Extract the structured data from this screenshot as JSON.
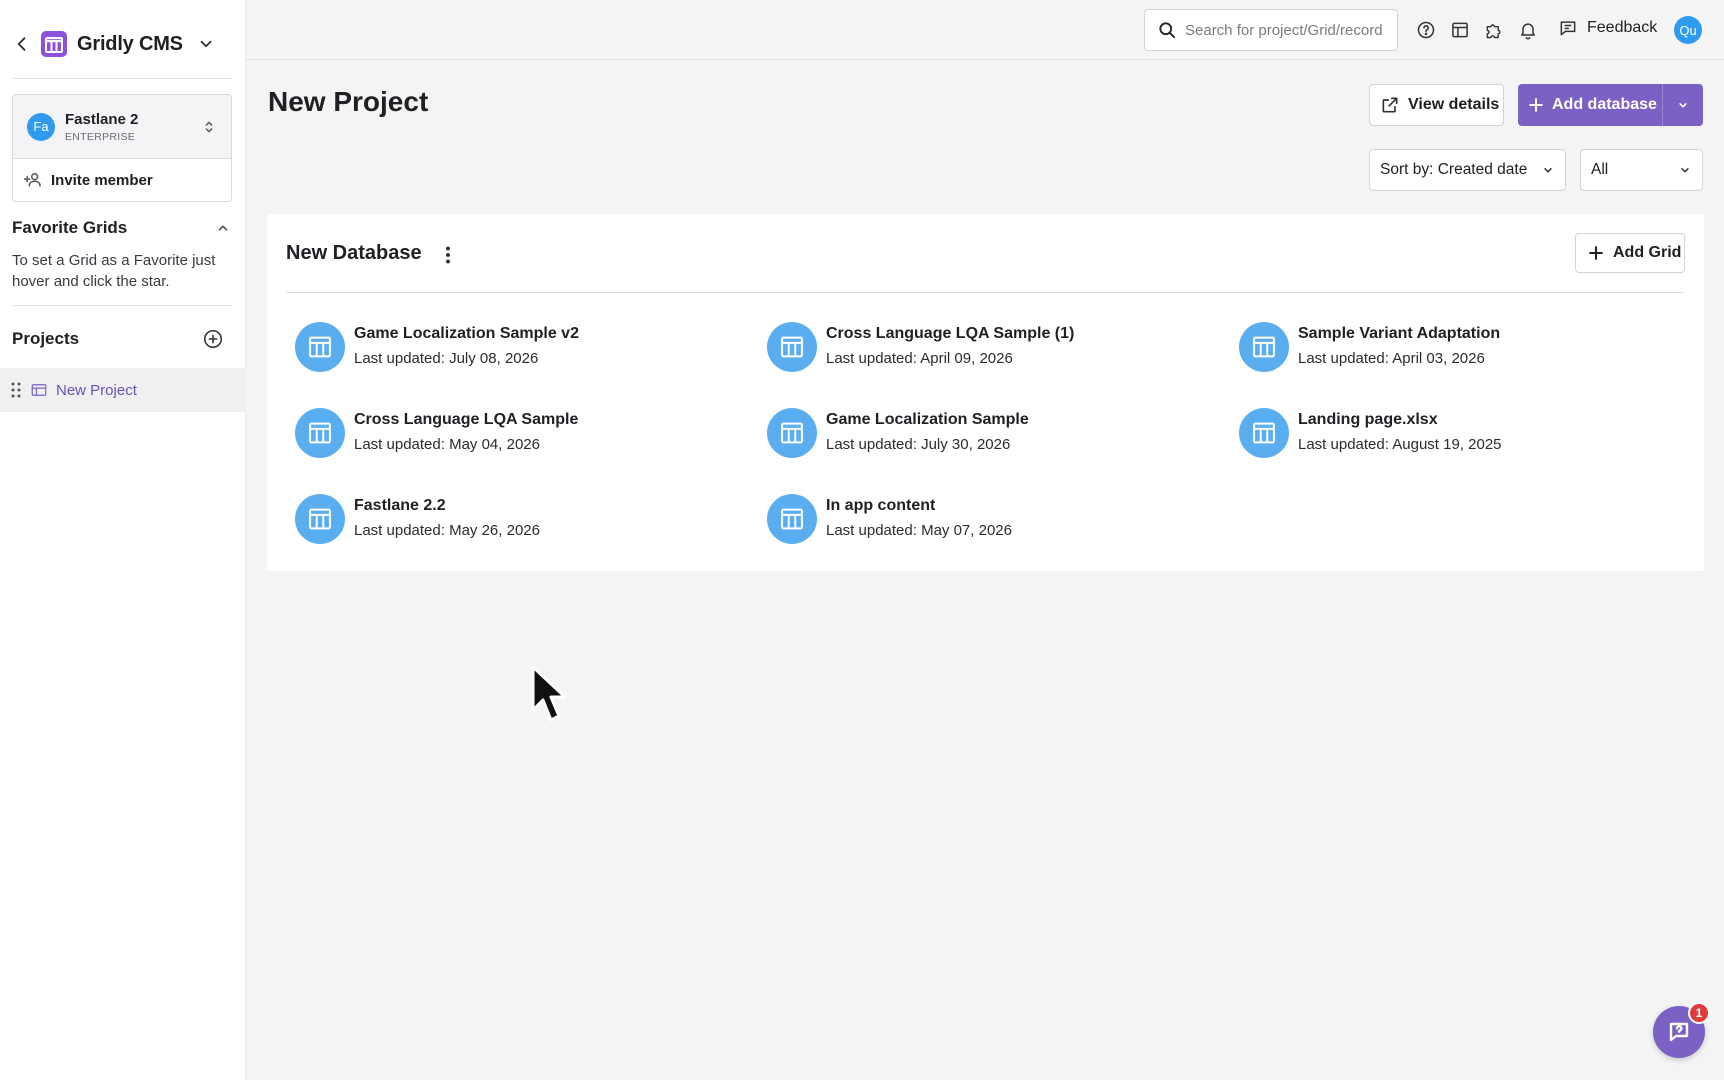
{
  "app": {
    "brand": "Gridly CMS",
    "accent_color": "#7b61c4",
    "avatar_color": "#2f9bef"
  },
  "sidebar": {
    "workspace": {
      "initials": "Fa",
      "name": "Fastlane 2",
      "plan": "ENTERPRISE",
      "invite_label": "Invite member"
    },
    "favorites": {
      "title": "Favorite Grids",
      "empty_text": "To set a Grid as a Favorite just hover and click the star."
    },
    "projects": {
      "title": "Projects",
      "items": [
        {
          "label": "New Project",
          "active": true
        }
      ]
    }
  },
  "topbar": {
    "search_placeholder": "Search for project/Grid/record",
    "feedback_label": "Feedback",
    "user_initials": "Qu",
    "icons": [
      "help-icon",
      "layout-icon",
      "puzzle-icon",
      "bell-icon",
      "feedback-icon"
    ]
  },
  "main": {
    "title": "New Project",
    "view_details_label": "View details",
    "add_database_label": "Add database",
    "sort_label": "Sort by: Created date",
    "filter_label": "All",
    "database": {
      "title": "New Database",
      "add_grid_label": "Add Grid",
      "grids": [
        {
          "name": "Game Localization Sample v2",
          "updated": "Last updated: July 08, 2026"
        },
        {
          "name": "Cross Language LQA Sample (1)",
          "updated": "Last updated: April 09, 2026"
        },
        {
          "name": "Sample Variant Adaptation",
          "updated": "Last updated: April 03, 2026"
        },
        {
          "name": "Cross Language LQA Sample",
          "updated": "Last updated: May 04, 2026"
        },
        {
          "name": "Game Localization Sample",
          "updated": "Last updated: July 30, 2026"
        },
        {
          "name": "Landing page.xlsx",
          "updated": "Last updated: August 19, 2025"
        },
        {
          "name": "Fastlane 2.2",
          "updated": "Last updated: May 26, 2026"
        },
        {
          "name": "In app content",
          "updated": "Last updated: May 07, 2026"
        }
      ]
    }
  },
  "chat": {
    "badge_count": "1"
  }
}
